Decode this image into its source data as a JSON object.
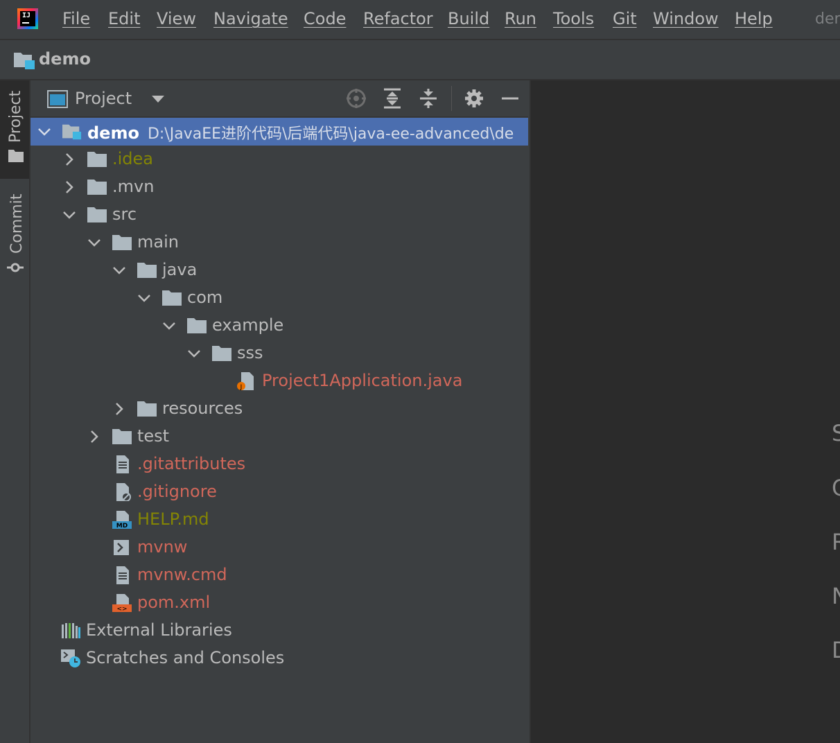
{
  "menubar": {
    "items": [
      "File",
      "Edit",
      "View",
      "Navigate",
      "Code",
      "Refactor",
      "Build",
      "Run",
      "Tools",
      "Git",
      "Window",
      "Help"
    ],
    "title_fragment": "der"
  },
  "navbar": {
    "project_name": "demo"
  },
  "stripe": {
    "project_tab": "Project",
    "commit_tab": "Commit"
  },
  "panel": {
    "title": "Project"
  },
  "tree": {
    "root": {
      "name": "demo",
      "path": "D:\\JavaEE进阶代码\\后端代码\\java-ee-advanced\\de"
    },
    "items": [
      {
        "label": ".idea",
        "color": "#848504"
      },
      {
        "label": ".mvn"
      },
      {
        "label": "src"
      },
      {
        "label": "main"
      },
      {
        "label": "java"
      },
      {
        "label": "com"
      },
      {
        "label": "example"
      },
      {
        "label": "sss"
      },
      {
        "label": "Project1Application.java",
        "color": "#d1675a"
      },
      {
        "label": "resources"
      },
      {
        "label": "test"
      },
      {
        "label": ".gitattributes",
        "color": "#d1675a"
      },
      {
        "label": ".gitignore",
        "color": "#d1675a"
      },
      {
        "label": "HELP.md",
        "color": "#848504"
      },
      {
        "label": "mvnw",
        "color": "#d1675a"
      },
      {
        "label": "mvnw.cmd",
        "color": "#d1675a"
      },
      {
        "label": "pom.xml",
        "color": "#d1675a"
      },
      {
        "label": "External Libraries"
      },
      {
        "label": "Scratches and Consoles"
      }
    ]
  },
  "editor": {
    "hint_letters": [
      "S",
      "G",
      "R",
      "N",
      "D"
    ]
  },
  "colors": {
    "selection": "#4b6eaf",
    "background": "#3c3f41",
    "editor_bg": "#2b2b2b",
    "ignored": "#848504",
    "unversioned": "#d1675a",
    "folder": "#aeb9c0"
  }
}
